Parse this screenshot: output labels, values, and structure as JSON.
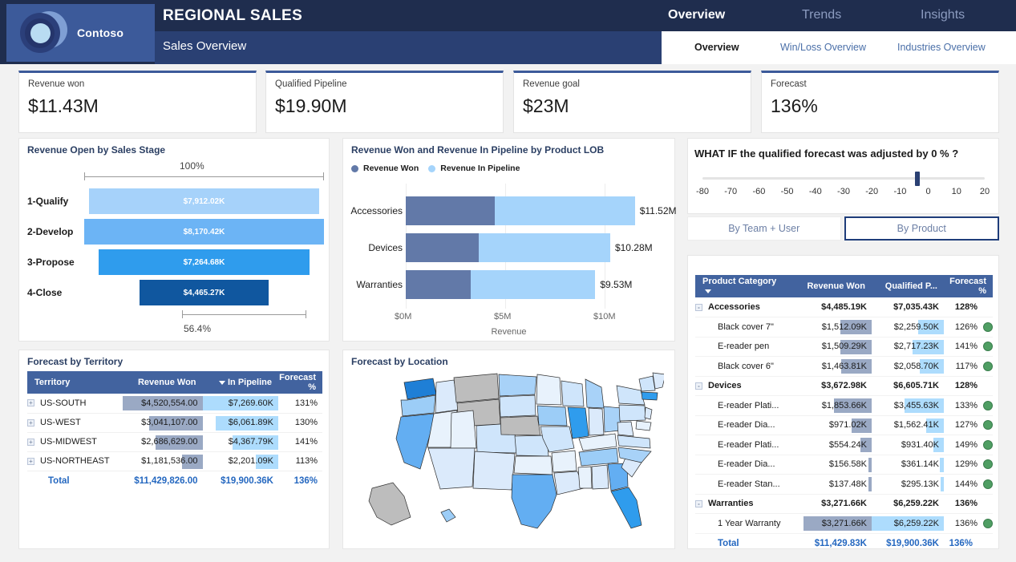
{
  "header": {
    "brand": "Contoso",
    "title": "REGIONAL SALES",
    "subtitle": "Sales Overview",
    "topnav": [
      {
        "label": "Overview",
        "active": true
      },
      {
        "label": "Trends",
        "active": false
      },
      {
        "label": "Insights",
        "active": false
      }
    ],
    "subnav": [
      {
        "label": "Overview",
        "active": true
      },
      {
        "label": "Win/Loss Overview",
        "active": false
      },
      {
        "label": "Industries Overview",
        "active": false
      }
    ]
  },
  "kpis": [
    {
      "label": "Revenue won",
      "value": "$11.43M"
    },
    {
      "label": "Qualified Pipeline",
      "value": "$19.90M"
    },
    {
      "label": "Revenue goal",
      "value": "$23M"
    },
    {
      "label": "Forecast",
      "value": "136%"
    }
  ],
  "funnel": {
    "title": "Revenue Open by Sales Stage",
    "top_pct": "100%",
    "bottom_pct": "56.4%"
  },
  "stacked": {
    "title": "Revenue Won and Revenue In Pipeline by Product LOB",
    "legend": [
      "Revenue Won",
      "Revenue In Pipeline"
    ],
    "xlabel": "Revenue",
    "xticks": [
      "$0M",
      "$5M",
      "$10M"
    ]
  },
  "whatif": {
    "question_pre": "WHAT IF the qualified forecast was adjusted by",
    "value": "0 %",
    "question_post": "?",
    "ticks": [
      "-80",
      "-70",
      "-60",
      "-50",
      "-40",
      "-30",
      "-20",
      "-10",
      "0",
      "10",
      "20"
    ],
    "buttons": [
      {
        "label": "By Team + User",
        "active": false
      },
      {
        "label": "By Product",
        "active": true
      }
    ]
  },
  "territory": {
    "title": "Forecast by Territory",
    "columns": [
      "Territory",
      "Revenue Won",
      "In Pipeline",
      "Forecast %"
    ],
    "rows": [
      {
        "name": "US-SOUTH",
        "revenue_won": "$4,520,554.00",
        "in_pipeline": "$7,269.60K",
        "forecast": "131%",
        "won_pct": 100,
        "pipe_pct": 100
      },
      {
        "name": "US-WEST",
        "revenue_won": "$3,041,107.00",
        "in_pipeline": "$6,061.89K",
        "forecast": "130%",
        "won_pct": 67,
        "pipe_pct": 83
      },
      {
        "name": "US-MIDWEST",
        "revenue_won": "$2,686,629.00",
        "in_pipeline": "$4,367.79K",
        "forecast": "141%",
        "won_pct": 59,
        "pipe_pct": 60
      },
      {
        "name": "US-NORTHEAST",
        "revenue_won": "$1,181,536.00",
        "in_pipeline": "$2,201.09K",
        "forecast": "113%",
        "won_pct": 26,
        "pipe_pct": 30
      }
    ],
    "total": {
      "name": "Total",
      "revenue_won": "$11,429,826.00",
      "in_pipeline": "$19,900.36K",
      "forecast": "136%"
    }
  },
  "map": {
    "title": "Forecast by Location"
  },
  "product": {
    "columns": [
      "Product Category",
      "Revenue Won",
      "Qualified P...",
      "Forecast %"
    ],
    "rows": [
      {
        "name": "Accessories",
        "group": true,
        "revenue_won": "$4,485.19K",
        "qualified": "$7,035.43K",
        "forecast": "128%",
        "won_pct": 0,
        "pipe_pct": 0,
        "dot": false
      },
      {
        "name": "Black cover 7\"",
        "group": false,
        "revenue_won": "$1,512.09K",
        "qualified": "$2,259.50K",
        "forecast": "126%",
        "won_pct": 41,
        "pipe_pct": 36,
        "dot": true
      },
      {
        "name": "E-reader pen",
        "group": false,
        "revenue_won": "$1,509.29K",
        "qualified": "$2,717.23K",
        "forecast": "141%",
        "won_pct": 41,
        "pipe_pct": 43,
        "dot": true
      },
      {
        "name": "Black cover 6\"",
        "group": false,
        "revenue_won": "$1,463.81K",
        "qualified": "$2,058.70K",
        "forecast": "117%",
        "won_pct": 40,
        "pipe_pct": 33,
        "dot": true
      },
      {
        "name": "Devices",
        "group": true,
        "revenue_won": "$3,672.98K",
        "qualified": "$6,605.71K",
        "forecast": "128%",
        "won_pct": 0,
        "pipe_pct": 0,
        "dot": false
      },
      {
        "name": "E-reader Plati...",
        "group": false,
        "revenue_won": "$1,853.66K",
        "qualified": "$3,455.63K",
        "forecast": "133%",
        "won_pct": 50,
        "pipe_pct": 55,
        "dot": true
      },
      {
        "name": "E-reader Dia...",
        "group": false,
        "revenue_won": "$971.02K",
        "qualified": "$1,562.41K",
        "forecast": "127%",
        "won_pct": 26,
        "pipe_pct": 25,
        "dot": true
      },
      {
        "name": "E-reader Plati...",
        "group": false,
        "revenue_won": "$554.24K",
        "qualified": "$931.40K",
        "forecast": "149%",
        "won_pct": 15,
        "pipe_pct": 15,
        "dot": true
      },
      {
        "name": "E-reader Dia...",
        "group": false,
        "revenue_won": "$156.58K",
        "qualified": "$361.14K",
        "forecast": "129%",
        "won_pct": 4,
        "pipe_pct": 6,
        "dot": true
      },
      {
        "name": "E-reader Stan...",
        "group": false,
        "revenue_won": "$137.48K",
        "qualified": "$295.13K",
        "forecast": "144%",
        "won_pct": 4,
        "pipe_pct": 5,
        "dot": true
      },
      {
        "name": "Warranties",
        "group": true,
        "revenue_won": "$3,271.66K",
        "qualified": "$6,259.22K",
        "forecast": "136%",
        "won_pct": 0,
        "pipe_pct": 0,
        "dot": false
      },
      {
        "name": "1 Year Warranty",
        "group": false,
        "revenue_won": "$3,271.66K",
        "qualified": "$6,259.22K",
        "forecast": "136%",
        "won_pct": 89,
        "pipe_pct": 100,
        "dot": true
      }
    ],
    "total": {
      "name": "Total",
      "revenue_won": "$11,429.83K",
      "qualified": "$19,900.36K",
      "forecast": "136%"
    }
  },
  "colors": {
    "header_dark": "#1f2d4e",
    "header_mid": "#2a4073",
    "logo_panel": "#3c5a9a",
    "table_header": "#42639f",
    "total_blue": "#2568c0",
    "revenue_won_bar": "#6279a8",
    "pipeline_bar": "#a5d4fb",
    "databar_won": "#9aa9c4",
    "databar_pipe": "#addcfd",
    "status_green": "#4f9e63"
  },
  "chart_data": [
    {
      "type": "bar",
      "title": "Revenue Open by Sales Stage",
      "orientation": "funnel",
      "categories": [
        "1-Qualify",
        "2-Develop",
        "3-Propose",
        "4-Close"
      ],
      "values": [
        7912.02,
        8170.42,
        7264.68,
        4465.27
      ],
      "labels": [
        "$7,912.02K",
        "$8,170.42K",
        "$7,264.68K",
        "$4,465.27K"
      ],
      "bar_colors": [
        "#a6d2fa",
        "#6cb4f5",
        "#2f9ced",
        "#10579f"
      ],
      "bar_widths_pct": [
        96,
        100,
        88,
        54
      ],
      "top_annotation": "100%",
      "bottom_annotation": "56.4%",
      "ylabel": "",
      "xlabel": "",
      "grid": false,
      "legend": "none"
    },
    {
      "type": "bar",
      "title": "Revenue Won and Revenue In Pipeline by Product LOB",
      "orientation": "horizontal",
      "stacked": true,
      "categories": [
        "Accessories",
        "Devices",
        "Warranties"
      ],
      "series": [
        {
          "name": "Revenue Won",
          "color": "#6279a8",
          "values": [
            4.49,
            3.67,
            3.27
          ]
        },
        {
          "name": "Revenue In Pipeline",
          "color": "#a5d4fb",
          "values": [
            7.03,
            6.61,
            6.26
          ]
        }
      ],
      "totals": [
        11.52,
        10.28,
        9.53
      ],
      "total_labels": [
        "$11.52M",
        "$10.28M",
        "$9.53M"
      ],
      "xlabel": "Revenue",
      "ylabel": "",
      "xticks": [
        0,
        5,
        10
      ],
      "xticklabels": [
        "$0M",
        "$5M",
        "$10M"
      ],
      "xlim": [
        0,
        12.5
      ],
      "grid": true,
      "legend": "top-left",
      "units": "USD millions"
    },
    {
      "type": "heatmap",
      "subtype": "choropleth",
      "title": "Forecast by Location",
      "region": "United States",
      "no_data_states": [
        "Montana",
        "Wyoming",
        "Nebraska",
        "Alaska"
      ],
      "high_states": [
        "Washington",
        "Texas",
        "Florida",
        "California",
        "Illinois",
        "Massachusetts"
      ],
      "colorscale": [
        "#e8f2fc",
        "#cfe5fb",
        "#a8d2f8",
        "#63aef2",
        "#1f7fd6"
      ]
    },
    {
      "type": "table",
      "title": "Forecast by Territory",
      "columns": [
        "Territory",
        "Revenue Won",
        "In Pipeline",
        "Forecast %"
      ],
      "rows": [
        [
          "US-SOUTH",
          "$4,520,554.00",
          "$7,269.60K",
          "131%"
        ],
        [
          "US-WEST",
          "$3,041,107.00",
          "$6,061.89K",
          "130%"
        ],
        [
          "US-MIDWEST",
          "$2,686,629.00",
          "$4,367.79K",
          "141%"
        ],
        [
          "US-NORTHEAST",
          "$1,181,536.00",
          "$2,201.09K",
          "113%"
        ],
        [
          "Total",
          "$11,429,826.00",
          "$19,900.36K",
          "136%"
        ]
      ]
    },
    {
      "type": "table",
      "title": "Product Category breakdown",
      "columns": [
        "Product Category",
        "Revenue Won",
        "Qualified P...",
        "Forecast %"
      ],
      "rows": [
        [
          "Accessories",
          "$4,485.19K",
          "$7,035.43K",
          "128%"
        ],
        [
          "Black cover 7\"",
          "$1,512.09K",
          "$2,259.50K",
          "126%"
        ],
        [
          "E-reader pen",
          "$1,509.29K",
          "$2,717.23K",
          "141%"
        ],
        [
          "Black cover 6\"",
          "$1,463.81K",
          "$2,058.70K",
          "117%"
        ],
        [
          "Devices",
          "$3,672.98K",
          "$6,605.71K",
          "128%"
        ],
        [
          "E-reader Plati...",
          "$1,853.66K",
          "$3,455.63K",
          "133%"
        ],
        [
          "E-reader Dia...",
          "$971.02K",
          "$1,562.41K",
          "127%"
        ],
        [
          "E-reader Plati...",
          "$554.24K",
          "$931.40K",
          "149%"
        ],
        [
          "E-reader Dia...",
          "$156.58K",
          "$361.14K",
          "129%"
        ],
        [
          "E-reader Stan...",
          "$137.48K",
          "$295.13K",
          "144%"
        ],
        [
          "Warranties",
          "$3,271.66K",
          "$6,259.22K",
          "136%"
        ],
        [
          "1 Year Warranty",
          "$3,271.66K",
          "$6,259.22K",
          "136%"
        ],
        [
          "Total",
          "$11,429.83K",
          "$19,900.36K",
          "136%"
        ]
      ]
    }
  ]
}
